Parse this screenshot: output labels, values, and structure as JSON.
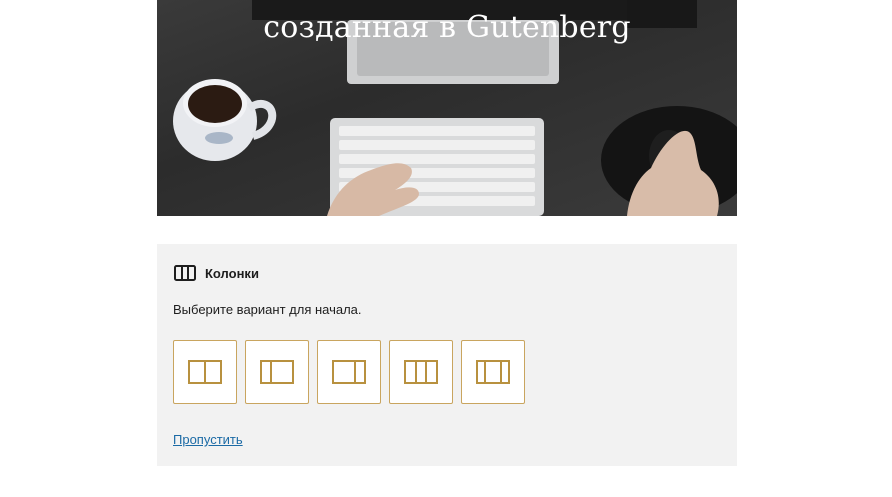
{
  "cover": {
    "title": "созданная в Gutenberg",
    "image": "desk-keyboard-coffee-mug-photo"
  },
  "columns_block": {
    "label": "Колонки",
    "icon": "columns-icon",
    "instructions": "Выберите вариант для начала.",
    "variations": [
      {
        "icon": "columns-50-50-icon"
      },
      {
        "icon": "columns-33-66-icon"
      },
      {
        "icon": "columns-66-33-icon"
      },
      {
        "icon": "columns-33-33-33-icon"
      },
      {
        "icon": "columns-25-50-25-icon"
      }
    ],
    "skip_label": "Пропустить"
  },
  "colors": {
    "accent_border": "#c9a55f",
    "link": "#1b6aa5",
    "placeholder_bg": "#f2f2f2",
    "icon_gold": "#b8913f"
  }
}
